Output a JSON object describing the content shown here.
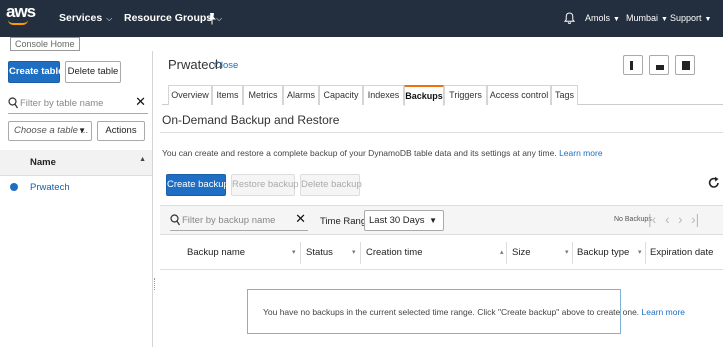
{
  "topnav": {
    "logo_text": "aws",
    "logo_tooltip": "Console Home",
    "services_label": "Services",
    "resource_groups_label": "Resource Groups",
    "user_label": "Amols",
    "region_label": "Mumbai",
    "support_label": "Support",
    "icons": [
      "chevron-down-icon",
      "pin-icon",
      "bell-icon"
    ]
  },
  "sidebar": {
    "create_table_label": "Create table",
    "delete_table_label": "Delete table",
    "filter_placeholder": "Filter by table name",
    "choose_table_placeholder": "Choose a table ...",
    "actions_label": "Actions",
    "column_header": "Name",
    "tables": [
      {
        "name": "Prwatech",
        "selected": true
      }
    ]
  },
  "main": {
    "table_title": "Prwatech",
    "close_label": "Close",
    "tabs": [
      {
        "label": "Overview",
        "active": false
      },
      {
        "label": "Items",
        "active": false
      },
      {
        "label": "Metrics",
        "active": false
      },
      {
        "label": "Alarms",
        "active": false
      },
      {
        "label": "Capacity",
        "active": false
      },
      {
        "label": "Indexes",
        "active": false
      },
      {
        "label": "Backups",
        "active": true
      },
      {
        "label": "Triggers",
        "active": false
      },
      {
        "label": "Access control",
        "active": false
      },
      {
        "label": "Tags",
        "active": false
      }
    ],
    "section_title": "On-Demand Backup and Restore",
    "description": "You can create and restore a complete backup of your DynamoDB table data and its settings at any time.",
    "learn_more_label": "Learn more",
    "create_backup_label": "Create backup",
    "restore_backup_label": "Restore backup",
    "delete_backup_label": "Delete backup",
    "backup_filter_placeholder": "Filter by backup name",
    "time_range_label": "Time Range",
    "time_range_value": "Last 30 Days",
    "no_backups_label": "No Backups",
    "columns": [
      "Backup name",
      "Status",
      "Creation time",
      "Size",
      "Backup type",
      "Expiration date"
    ],
    "empty_message": "You have no backups in the current selected time range. Click \"Create backup\" above to create one.",
    "empty_learn_more": "Learn more"
  },
  "colors": {
    "topbar": "#232f3e",
    "primary": "#1e6fc4",
    "active_tab_accent": "#ec7211",
    "link": "#1a6fc4"
  }
}
